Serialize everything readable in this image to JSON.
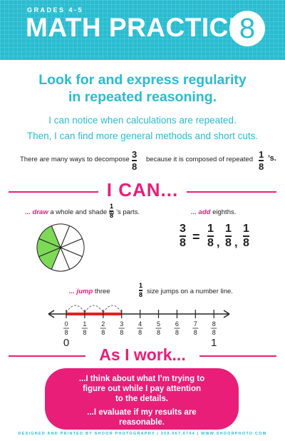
{
  "header": {
    "grades": "GRADES 4-5",
    "title": "MATH PRACTICES",
    "number": "8"
  },
  "intro": {
    "heading_line1": "Look for and express regularity",
    "heading_line2": "in repeated reasoning.",
    "sub_line1": "I can notice when calculations are repeated.",
    "sub_line2": "Then, I can find more general methods and short cuts.",
    "decompose_text1": "There are many ways to decompose",
    "decompose_text2": "because it is composed of repeated",
    "decompose_suffix": "’s.",
    "frac_num": "3",
    "frac_den": "8",
    "unit_num": "1",
    "unit_den": "8"
  },
  "ican": {
    "heading": "I CAN...",
    "draw_em": "... draw",
    "draw_text1": "a whole and shade in",
    "draw_text2": "’s parts.",
    "add_em": "... add",
    "add_text": "eighths.",
    "jump_em": "... jump",
    "jump_text1": "three",
    "jump_text2": "size jumps on a number line.",
    "eq_sign": "=",
    "comma": ","
  },
  "pie": {
    "slices": 8,
    "shaded": 3,
    "shade_color": "#7ed957"
  },
  "number_line": {
    "numerators": [
      "0",
      "1",
      "2",
      "3",
      "4",
      "5",
      "6",
      "7",
      "8"
    ],
    "denominator": "8",
    "start_label": "0",
    "end_label": "1",
    "highlight_to": 3,
    "jumps": 3
  },
  "work": {
    "heading": "As I work...",
    "line1": "...I think about what I’m trying to",
    "line2": "figure out while I pay attention",
    "line3": "to the details.",
    "line4": "...I evaluate if my results are",
    "line5": "reasonable."
  },
  "footer": "DESIGNED AND PRINTED BY SHOOR PHOTOGRAPHY | 209.567.6744 | WWW.SHOORPHOTO.COM",
  "colors": {
    "teal": "#29bcd0",
    "pink": "#e91e79",
    "green": "#7ed957"
  }
}
